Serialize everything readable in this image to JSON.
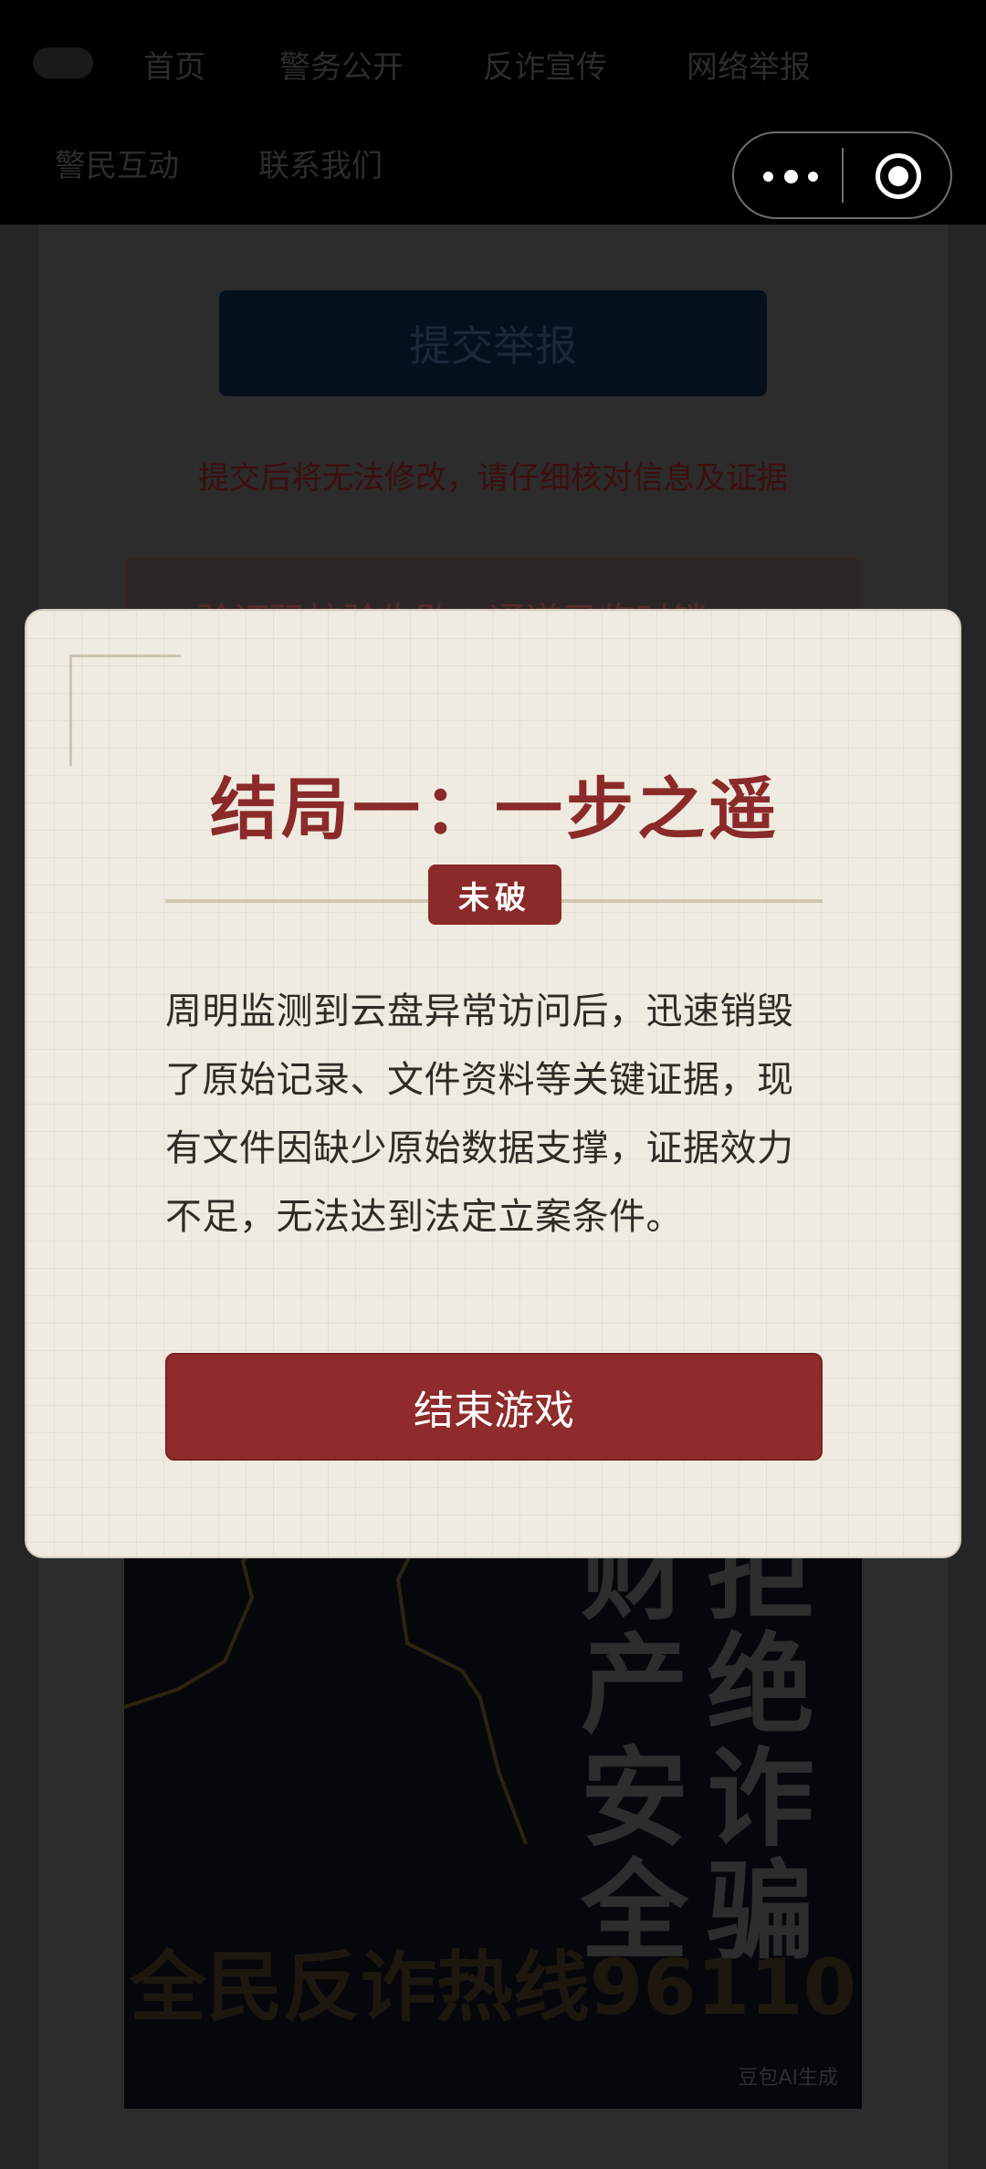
{
  "nav": {
    "items": [
      "首页",
      "警务公开",
      "反诈宣传",
      "网络举报",
      "警民互动",
      "联系我们"
    ]
  },
  "capsule": {
    "more_icon": "more-dots-icon",
    "close_icon": "target-circle-icon"
  },
  "form": {
    "submit_label": "提交举报",
    "warning": "提交后将无法修改，请仔细核对信息及证据",
    "error_text": "验证码校验失败，通道已临时锁"
  },
  "poster": {
    "headline_left": "财产安全",
    "headline_right": "拒绝诈骗",
    "hotline": "全民反诈热线96110",
    "credit": "豆包AI生成"
  },
  "modal": {
    "title": "结局一：一步之遥",
    "badge": "未破",
    "body": "周明监测到云盘异常访问后，迅速销毁了原始记录、文件资料等关键证据，现有文件因缺少原始数据支撑，证据效力不足，无法达到法定立案条件。",
    "button_label": "结束游戏"
  },
  "colors": {
    "accent": "#8b2a2a",
    "modal_bg": "#f0ebe1",
    "nav_bg": "#000000"
  }
}
